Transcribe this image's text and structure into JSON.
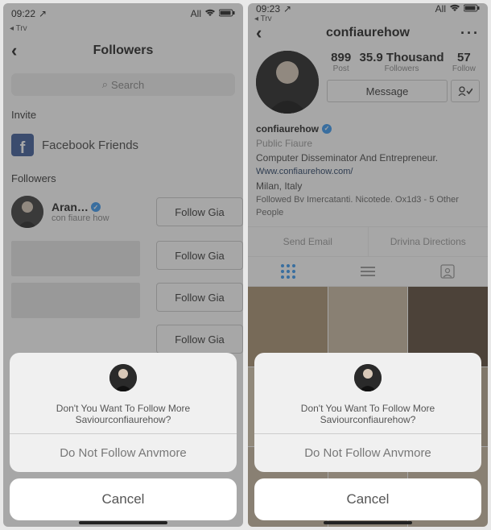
{
  "left": {
    "status": {
      "time": "09:22",
      "try": "◂ Trv",
      "net": "All",
      "wifi": "wifi",
      "batt": "batt"
    },
    "nav": {
      "title": "Followers"
    },
    "search": {
      "placeholder": "Search"
    },
    "invite_head": "Invite",
    "fb": {
      "label": "Facebook Friends"
    },
    "followers_head": "Followers",
    "rows": [
      {
        "name": "Aran…",
        "sub": "con fiaure how",
        "btn": "Follow Gia"
      },
      {
        "name": "",
        "sub": "",
        "btn": "Follow Gia"
      },
      {
        "name": "",
        "sub": "",
        "btn": "Follow Gia"
      },
      {
        "name": "",
        "sub": "",
        "btn": "Follow Gia"
      }
    ],
    "sheet": {
      "message": "Don't You Want To Follow More Saviourconfiaurehow?",
      "option": "Do Not Follow Anvmore",
      "cancel": "Cancel"
    }
  },
  "right": {
    "status": {
      "time": "09:23",
      "try": "◂ Trv",
      "net": "All"
    },
    "nav": {
      "title": "confiaurehow"
    },
    "stats": {
      "posts_n": "899",
      "posts_l": "Post",
      "followers_n": "35.9 Thousand",
      "followers_l": "Followers",
      "following_n": "57",
      "following_l": "Follow"
    },
    "msg_btn": "Message",
    "bio": {
      "uname": "confiaurehow",
      "role": "Public Fiaure",
      "desc": "Computer Disseminator And Entrepreneur.",
      "link": "Www.confiaurehow.com/",
      "place": "Milan, Italy",
      "followed": "Followed Bv Imercatanti. Nicotede. Ox1d3 - 5 Other People"
    },
    "actions": {
      "email": "Send Email",
      "directions": "Drivina Directions"
    },
    "sheet": {
      "message": "Don't You Want To Follow More Saviourconfiaurehow?",
      "option": "Do Not Follow Anvmore",
      "cancel": "Cancel"
    }
  }
}
